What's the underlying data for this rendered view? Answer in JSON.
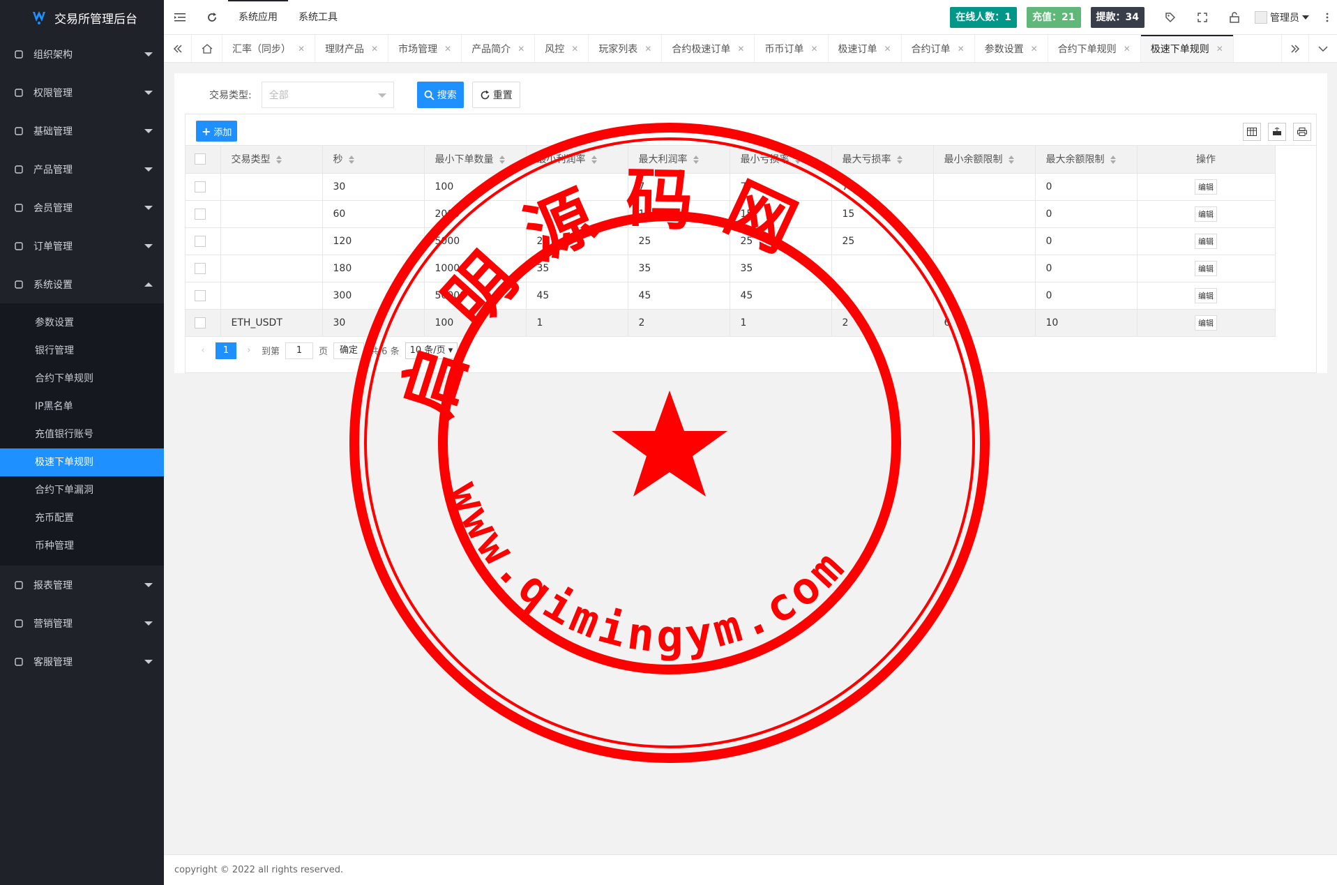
{
  "app": {
    "title": "交易所管理后台",
    "logo_icon": "exchange-logo-icon"
  },
  "sidebar": {
    "items": [
      {
        "label": "组织架构",
        "icon": "org-icon"
      },
      {
        "label": "权限管理",
        "icon": "shield-icon"
      },
      {
        "label": "基础管理",
        "icon": "basic-icon"
      },
      {
        "label": "产品管理",
        "icon": "flag-icon"
      },
      {
        "label": "会员管理",
        "icon": "user-icon"
      },
      {
        "label": "订单管理",
        "icon": "order-icon"
      },
      {
        "label": "系统设置",
        "icon": "gear-icon",
        "expanded": true
      }
    ],
    "submenu": [
      "参数设置",
      "银行管理",
      "合约下单规则",
      "IP黑名单",
      "充值银行账号",
      "极速下单规则",
      "合约下单漏洞",
      "充币配置",
      "币种管理"
    ],
    "active_sub": "极速下单规则",
    "items_after": [
      {
        "label": "报表管理",
        "icon": "report-icon"
      },
      {
        "label": "营销管理",
        "icon": "marketing-icon"
      },
      {
        "label": "客服管理",
        "icon": "service-icon"
      }
    ]
  },
  "topbar": {
    "links": [
      "系统应用",
      "系统工具"
    ],
    "online_label": "在线人数：1",
    "recharge_label": "充值：21",
    "withdraw_label": "提款：34",
    "admin_label": "管理员",
    "colors": {
      "online": "#009688",
      "recharge": "#5fb878",
      "withdraw": "#393d49"
    }
  },
  "tabs": [
    "汇率（同步）",
    "理财产品",
    "市场管理",
    "产品简介",
    "风控",
    "玩家列表",
    "合约极速订单",
    "币币订单",
    "极速订单",
    "合约订单",
    "参数设置",
    "合约下单规则",
    "极速下单规则"
  ],
  "active_tab": "极速下单规则",
  "search": {
    "label": "交易类型:",
    "placeholder": "全部",
    "search_btn": "搜索",
    "reset_btn": "重置"
  },
  "table": {
    "add_btn": "添加",
    "columns": [
      "交易类型",
      "秒",
      "最小下单数量",
      "最小利润率",
      "最大利润率",
      "最小亏损率",
      "最大亏损率",
      "最小余额限制",
      "最大余额限制",
      "操作"
    ],
    "rows": [
      [
        "",
        "30",
        "100",
        "",
        "7",
        "7",
        "7",
        "",
        "0"
      ],
      [
        "",
        "60",
        "2000",
        "",
        "15",
        "15",
        "15",
        "",
        "0"
      ],
      [
        "",
        "120",
        "5000",
        "25",
        "25",
        "25",
        "25",
        "",
        "0"
      ],
      [
        "",
        "180",
        "10000",
        "35",
        "35",
        "35",
        "",
        "",
        "0"
      ],
      [
        "",
        "300",
        "50000",
        "45",
        "45",
        "45",
        "",
        "",
        "0"
      ],
      [
        "ETH_USDT",
        "30",
        "100",
        "1",
        "2",
        "1",
        "2",
        "6",
        "10"
      ]
    ],
    "edit_label": "编辑"
  },
  "pager": {
    "current": "1",
    "goto": "到第",
    "page_input": "1",
    "page_unit": "页",
    "confirm": "确定",
    "total": "共 6 条",
    "per_page": "10 条/页"
  },
  "footer": {
    "copyright": "copyright © 2022 all rights reserved."
  },
  "watermark": {
    "top_text": "启明源码网",
    "bottom_text": "www.qimingym.com",
    "color": "#ff0000"
  }
}
